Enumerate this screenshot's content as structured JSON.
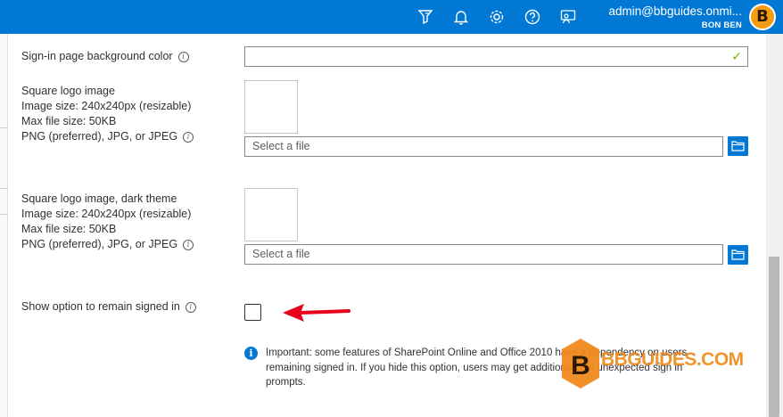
{
  "header": {
    "account_email": "admin@bbguides.onmi...",
    "account_name": "BON BEN",
    "avatar_letter": "B",
    "icons": [
      "feedback-filter-icon",
      "bell-icon",
      "gear-icon",
      "help-icon",
      "feedback-person-icon"
    ]
  },
  "form": {
    "bg_color": {
      "label": "Sign-in page background color",
      "value": ""
    },
    "square_logo": {
      "label_lines": [
        "Square logo image",
        "Image size: 240x240px (resizable)",
        "Max file size: 50KB",
        "PNG (preferred), JPG, or JPEG"
      ],
      "placeholder": "Select a file"
    },
    "square_logo_dark": {
      "label_lines": [
        "Square logo image, dark theme",
        "Image size: 240x240px (resizable)",
        "Max file size: 50KB",
        "PNG (preferred), JPG, or JPEG"
      ],
      "placeholder": "Select a file"
    },
    "remain_signed_in": {
      "label": "Show option to remain signed in",
      "checked": false
    },
    "note": {
      "lines": [
        "Important: some features of SharePoint Online and Office 2010 have a dependency on users",
        "remaining signed in. If you hide this option, users may get additional and unexpected sign in",
        "prompts."
      ]
    }
  },
  "watermark": {
    "letter": "B",
    "text": "BBGUIDES.COM"
  },
  "colors": {
    "accent": "#0078d4",
    "avatar": "#f39c12",
    "valid_check": "#6bb700",
    "arrow": "#e8001c",
    "watermark": "#f08a1c"
  }
}
